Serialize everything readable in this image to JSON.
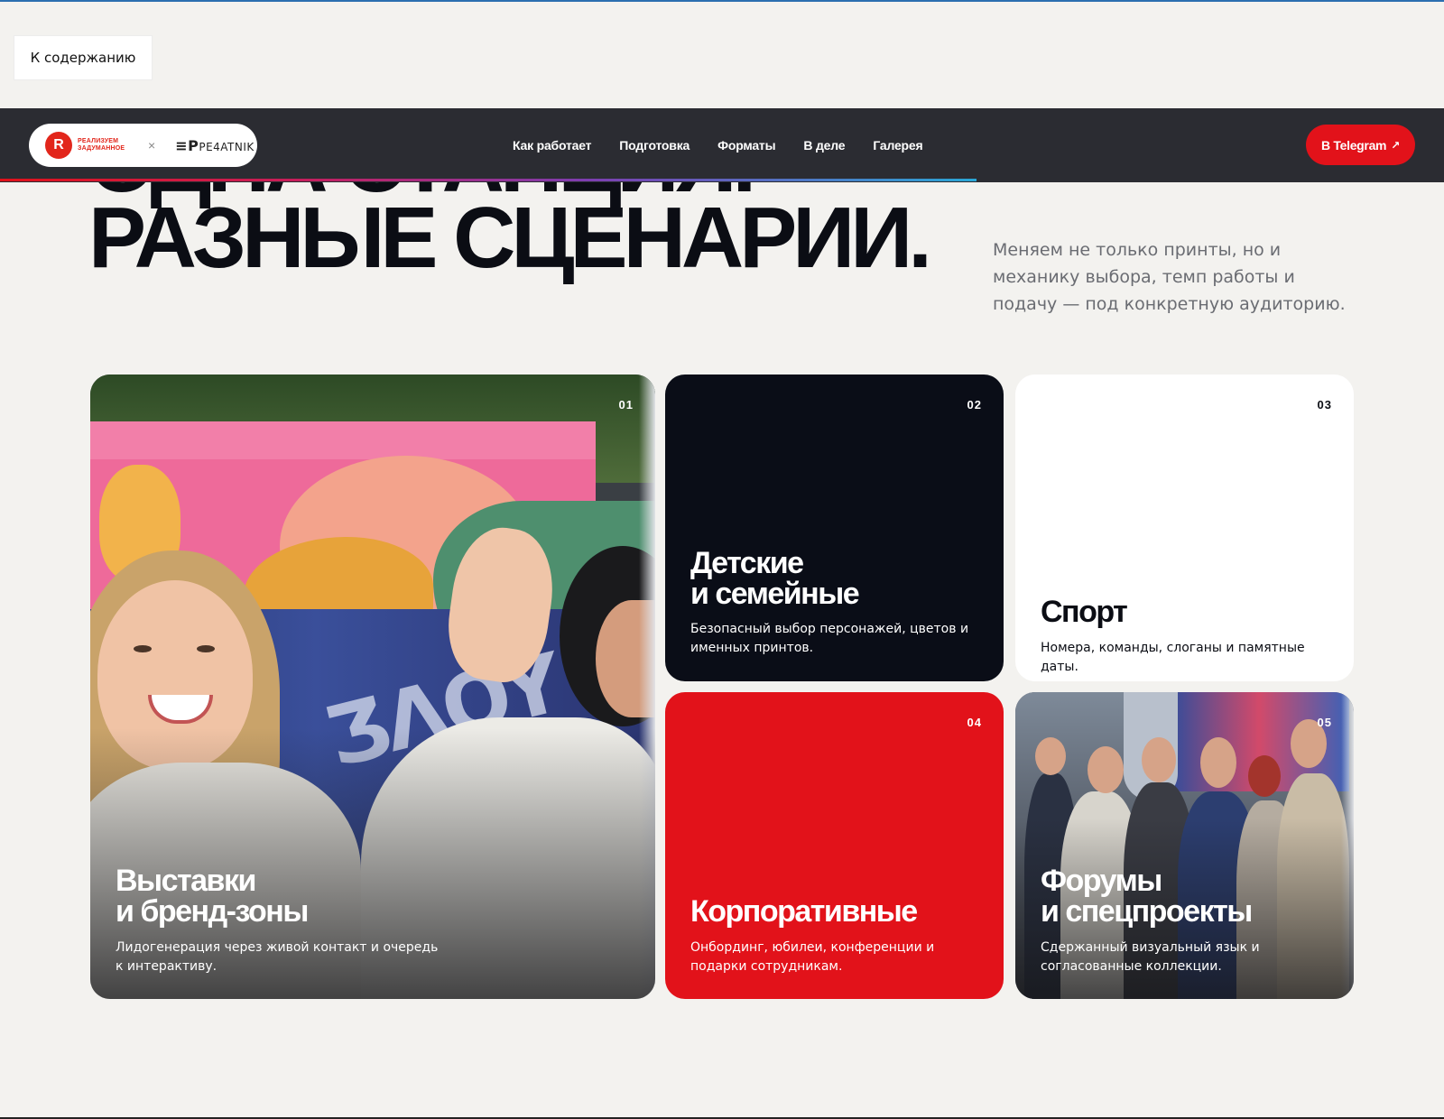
{
  "skip_link": "К содержанию",
  "header": {
    "logo_left_letter": "R",
    "logo_left_text": "РЕАЛИЗУЕМ ЗАДУМАННОЕ",
    "logo_separator": "×",
    "logo_right_mark": "≡P",
    "logo_right_text": "PE4ATNIK",
    "nav": [
      "Как работает",
      "Подготовка",
      "Форматы",
      "В деле",
      "Галерея"
    ],
    "cta_label": "В Telegram",
    "cta_icon": "↗"
  },
  "hero": {
    "title_line1": "ОДНА СТАНЦИЯ.",
    "title_line2": "РАЗНЫЕ СЦЕНАРИИ.",
    "subtitle": "Меняем не только принты, но и механику выбора, темп работы и подачу — под конкретную аудиторию."
  },
  "cards": [
    {
      "num": "01",
      "title_line1": "Выставки",
      "title_line2": "и бренд-зоны",
      "desc": "Лидогенерация через живой контакт и очередь к интерактиву."
    },
    {
      "num": "02",
      "title_line1": "Детские",
      "title_line2": "и семейные",
      "desc": "Безопасный выбор персонажей, цветов и именных принтов."
    },
    {
      "num": "03",
      "title_line1": "Спорт",
      "title_line2": "",
      "desc": "Номера, команды, слоганы и памятные даты."
    },
    {
      "num": "04",
      "title_line1": "Корпоративные",
      "title_line2": "",
      "desc": "Онбординг, юбилеи, конференции и подарки сотрудникам."
    },
    {
      "num": "05",
      "title_line1": "Форумы",
      "title_line2": "и спецпроекты",
      "desc": "Сдержанный визуальный язык и согласованные коллекции."
    }
  ],
  "colors": {
    "accent_red": "#e2121a",
    "navbar": "#2b2c32",
    "dark_card": "#0a0d17",
    "background": "#f3f2ef"
  }
}
